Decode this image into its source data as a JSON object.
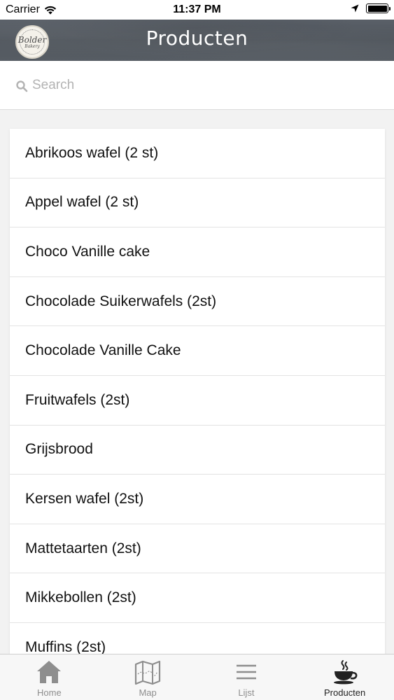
{
  "status_bar": {
    "carrier": "Carrier",
    "time": "11:37 PM"
  },
  "nav": {
    "title": "Producten",
    "logo_word": "Bolder",
    "logo_sub": "Bakery"
  },
  "search": {
    "placeholder": "Search",
    "value": ""
  },
  "products": [
    "Abrikoos wafel (2 st)",
    "Appel wafel (2 st)",
    "Choco Vanille cake",
    "Chocolade Suikerwafels (2st)",
    "Chocolade Vanille Cake",
    "Fruitwafels (2st)",
    "Grijsbrood",
    "Kersen wafel (2st)",
    "Mattetaarten (2st)",
    "Mikkebollen (2st)",
    "Muffins (2st)"
  ],
  "tabs": [
    {
      "label": "Home",
      "icon": "home-icon",
      "active": false
    },
    {
      "label": "Map",
      "icon": "map-icon",
      "active": false
    },
    {
      "label": "Lijst",
      "icon": "list-icon",
      "active": false
    },
    {
      "label": "Producten",
      "icon": "coffee-cup-icon",
      "active": true
    }
  ],
  "colors": {
    "nav_background": "#53595f",
    "tab_active": "#222222",
    "tab_inactive": "#8e8e8e"
  }
}
